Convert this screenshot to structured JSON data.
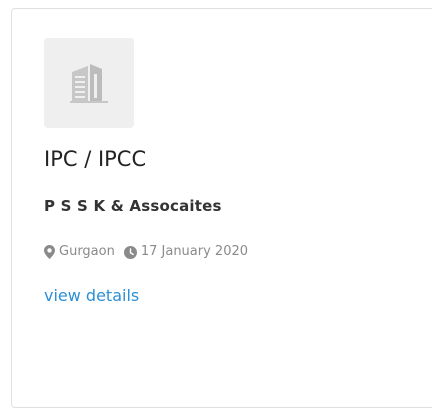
{
  "listing": {
    "title": "IPC / IPCC",
    "company": "P S S K & Assocaites",
    "location": "Gurgaon",
    "date": "17 January 2020",
    "details_link": "view details"
  },
  "icons": {
    "logo": "building-icon",
    "location": "map-marker-icon",
    "date": "clock-icon"
  },
  "colors": {
    "link": "#2b8fd6",
    "meta_text": "#8a8a8a",
    "logo_bg": "#efefef"
  }
}
